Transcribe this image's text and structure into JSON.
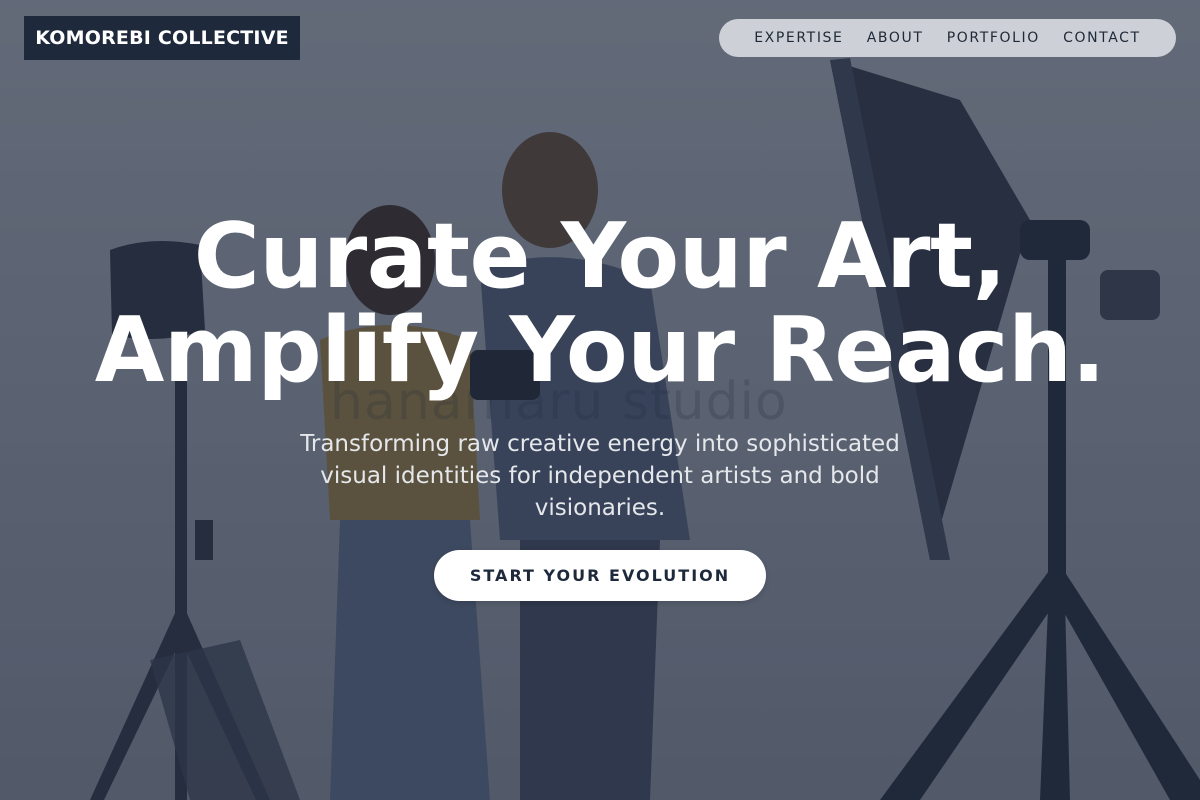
{
  "brand": {
    "name": "KOMOREBI COLLECTIVE"
  },
  "nav": {
    "items": [
      {
        "label": "EXPERTISE"
      },
      {
        "label": "ABOUT"
      },
      {
        "label": "PORTFOLIO"
      },
      {
        "label": "CONTACT"
      }
    ]
  },
  "hero": {
    "headline_line1": "Curate Your Art,",
    "headline_line2": "Amplify Your Reach.",
    "subtext": "Transforming raw creative energy into sophisticated visual identities for independent artists and bold visionaries.",
    "cta_label": "START YOUR EVOLUTION",
    "watermark": "hanamaru studio"
  },
  "colors": {
    "brand_bg": "#1e293b",
    "nav_bg": "#e5e7eb",
    "cta_bg": "#ffffff",
    "cta_text": "#1e293b",
    "headline": "#ffffff"
  }
}
